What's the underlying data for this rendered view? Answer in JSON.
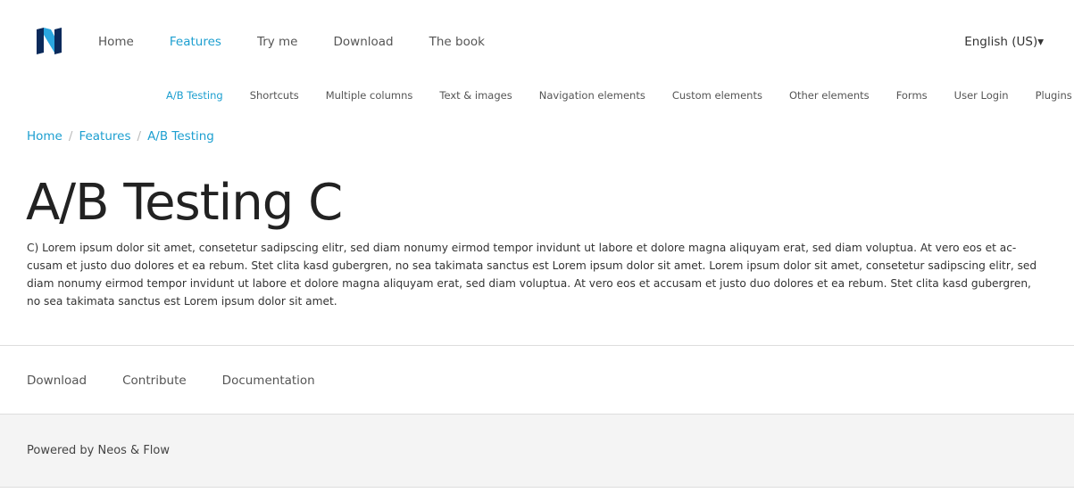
{
  "header": {
    "logo_alt": "N",
    "main_nav": [
      {
        "label": "Home",
        "active": false
      },
      {
        "label": "Features",
        "active": true
      },
      {
        "label": "Try me",
        "active": false
      },
      {
        "label": "Download",
        "active": false
      },
      {
        "label": "The book",
        "active": false
      }
    ],
    "language": "English (US)▾"
  },
  "sub_nav": [
    {
      "label": "A/B Testing",
      "active": true
    },
    {
      "label": "Shortcuts",
      "active": false
    },
    {
      "label": "Multiple columns",
      "active": false
    },
    {
      "label": "Text & images",
      "active": false
    },
    {
      "label": "Navigation elements",
      "active": false
    },
    {
      "label": "Custom elements",
      "active": false
    },
    {
      "label": "Other elements",
      "active": false
    },
    {
      "label": "Forms",
      "active": false
    },
    {
      "label": "User Login",
      "active": false
    },
    {
      "label": "Plugins",
      "active": false
    }
  ],
  "breadcrumb": [
    "Home",
    "Features",
    "A/B Testing"
  ],
  "breadcrumb_sep": "/",
  "main": {
    "title": "A/B Testing C",
    "body": "C) Lorem ipsum dolor sit amet, consetetur sadipscing elitr, sed diam nonumy eirmod tempor invidunt ut labore et dolore magna aliquyam erat, sed diam voluptua. At vero eos et ac­cusam et justo duo dolores et ea rebum. Stet clita kasd gubergren, no sea takimata sanctus est Lorem ipsum dolor sit amet. Lorem ipsum dolor sit amet, consetetur sadipscing elitr, sed diam nonumy eirmod tempor invidunt ut labore et dolore magna aliquyam erat, sed diam voluptua. At vero eos et accusam et justo duo dolores et ea rebum. Stet clita kasd gubergren, no sea takimata sanctus est Lorem ipsum dolor sit amet."
  },
  "footer_nav": [
    "Download",
    "Contribute",
    "Documentation"
  ],
  "footer": {
    "powered_by": "Powered by Neos & Flow"
  },
  "colors": {
    "accent": "#1d9fd0",
    "logo_dark": "#0b2a5b",
    "logo_light": "#2aa6df"
  }
}
